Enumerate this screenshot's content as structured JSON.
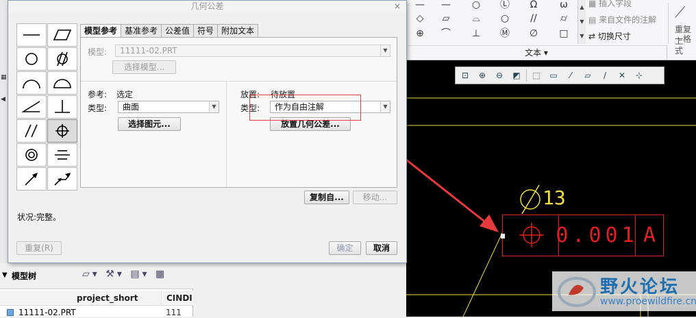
{
  "dialog": {
    "title": "几何公差",
    "close_symbol": "×",
    "tabs": [
      "模型参考",
      "基准参考",
      "公差值",
      "符号",
      "附加文本"
    ],
    "model": {
      "label": "模型:",
      "value": "11111-02.PRT",
      "select_button": "选择模型..."
    },
    "reference": {
      "label": "参考:",
      "value": "选定",
      "type_label": "类型:",
      "type_value": "曲面",
      "select_button": "选择图元..."
    },
    "placement": {
      "label": "放置:",
      "value": "待放置",
      "type_label": "类型:",
      "type_value": "作为自由注解",
      "place_button": "放置几何公差..."
    },
    "copy_button": "复制自...",
    "move_button": "移动...",
    "status": "状况:完整。",
    "redo_button": "重复(R)",
    "ok_button": "确定",
    "cancel_button": "取消"
  },
  "ribbon": {
    "insert_note": "插入字段",
    "note_from_file": "来自文件的注解",
    "toggle_dimension": "切换尺寸",
    "repeat_label": "重复上",
    "repeat_label2": "一格式",
    "group_label": "文本 ▾"
  },
  "drawing": {
    "diameter_value": "13",
    "tolerance_value": "0.001",
    "datum": "A",
    "line_color": "#f0e040",
    "frame_color": "#e02020"
  },
  "model_tree": {
    "title": "模型树",
    "columns": [
      "project_short",
      "CINDI"
    ],
    "rows": [
      {
        "name": "11111-02.PRT",
        "value": "111"
      }
    ]
  },
  "watermark": {
    "name": "野火论坛",
    "url": "www.proewildfire.cn"
  }
}
